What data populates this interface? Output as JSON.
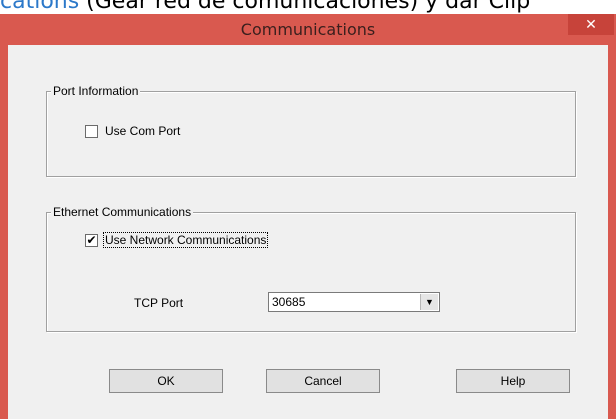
{
  "background_doc": {
    "link_text": "cations",
    "text": " (Gear red de comunicaciones) y dar Clip"
  },
  "window": {
    "title": "Communications",
    "close_glyph": "✕",
    "accent_color": "#d9594f"
  },
  "port_info": {
    "legend": "Port Information",
    "use_com_port_label": "Use Com Port",
    "use_com_port_checked": false
  },
  "ethernet": {
    "legend": "Ethernet Communications",
    "use_network_label": "Use Network Communications",
    "use_network_checked": true,
    "check_glyph": "✔",
    "tcp_port_label": "TCP Port",
    "tcp_port_value": "30685",
    "dropdown_glyph": "▼"
  },
  "buttons": {
    "ok": "OK",
    "cancel": "Cancel",
    "help": "Help"
  }
}
